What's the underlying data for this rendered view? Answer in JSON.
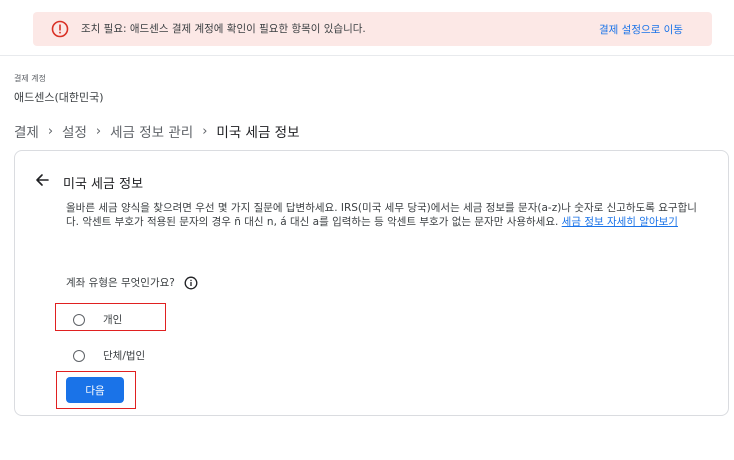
{
  "alert": {
    "text": "조치 필요: 애드센스 결제 계정에 확인이 필요한 항목이 있습니다.",
    "link": "결제 설정으로 이동",
    "icon": "alert-circle-icon",
    "color": "#d93025",
    "background": "#fce8e6"
  },
  "account": {
    "label": "결제 계정",
    "name": "애드센스(대한민국)"
  },
  "breadcrumb": {
    "items": [
      "결제",
      "설정",
      "세금 정보 관리",
      "미국 세금 정보"
    ],
    "separator": "›"
  },
  "card": {
    "title": "미국 세금 정보",
    "description": "올바른 세금 양식을 찾으려면 우선 몇 가지 질문에 답변하세요. IRS(미국 세무 당국)에서는 세금 정보를 문자(a-z)나 숫자로 신고하도록 요구합니다. 악센트 부호가 적용된 문자의 경우 ñ 대신 n, á 대신 a를 입력하는 등 악센트 부호가 없는 문자만 사용하세요. ",
    "learn_more": "세금 정보 자세히 알아보기",
    "question": "계좌 유형은 무엇인가요?",
    "options": [
      "개인",
      "단체/법인"
    ],
    "next_button": "다음"
  },
  "colors": {
    "accent": "#1a73e8",
    "highlight": "#e02020"
  }
}
